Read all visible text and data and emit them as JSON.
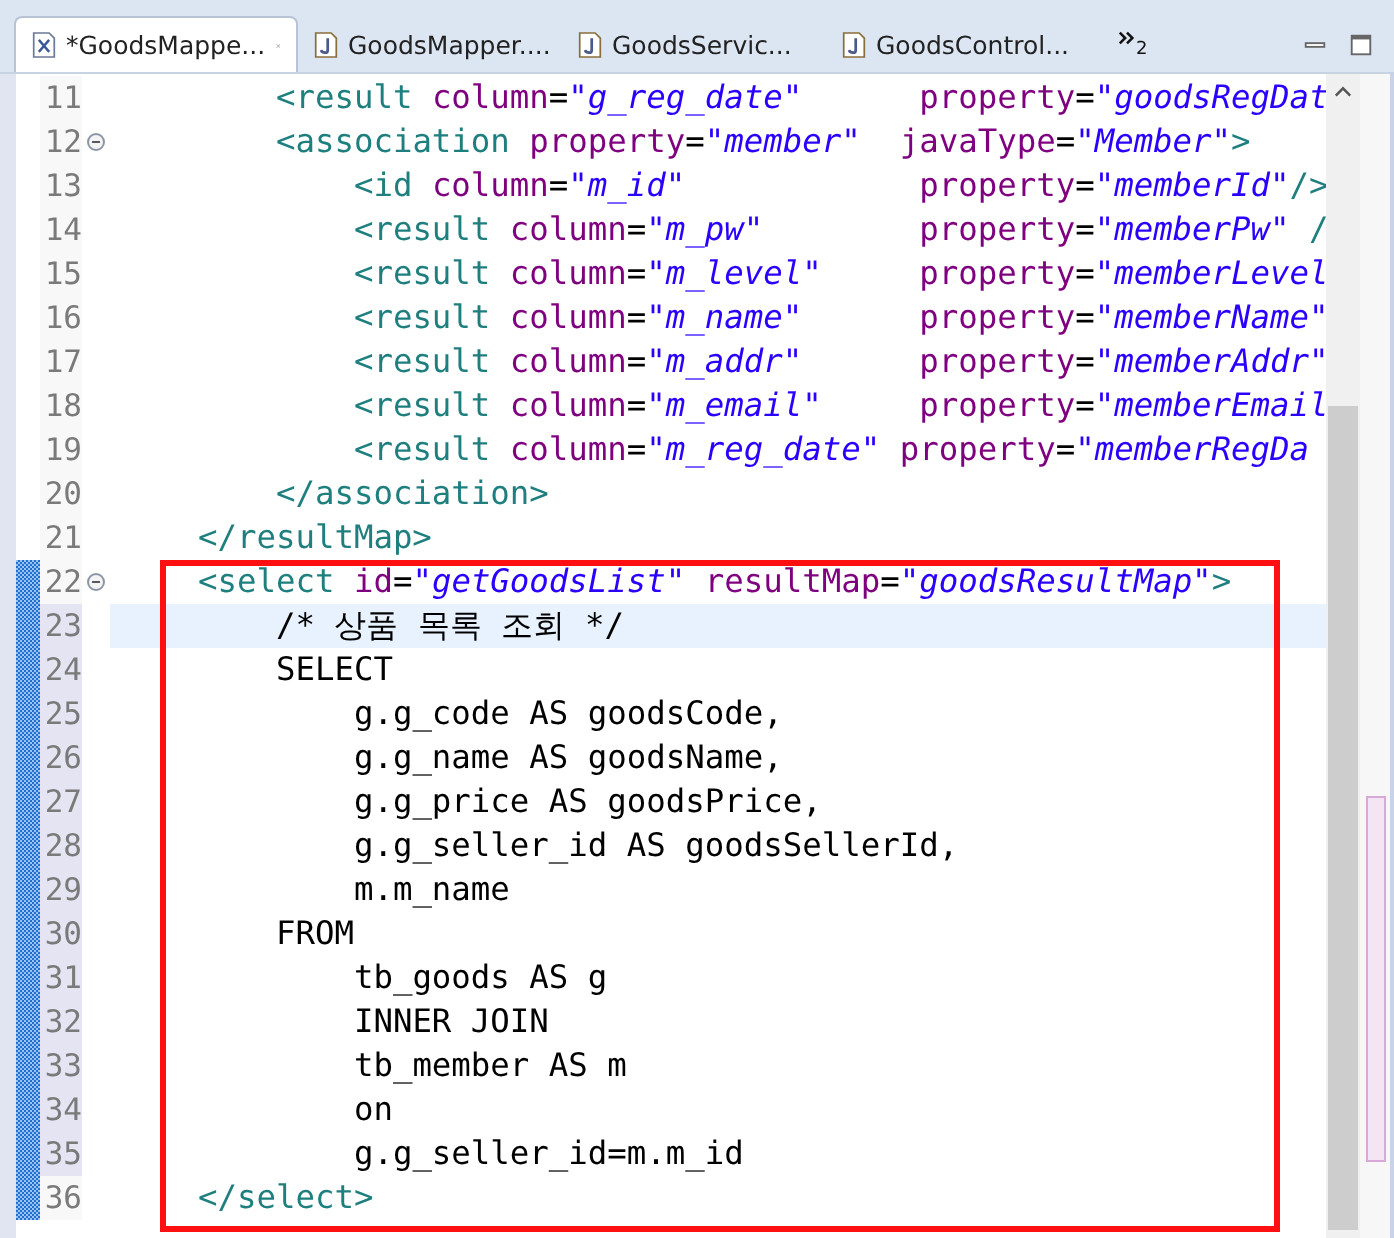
{
  "tabs": [
    {
      "label": "*GoodsMappe...",
      "kind": "xml",
      "selected": true,
      "closable": true
    },
    {
      "label": "GoodsMapper....",
      "kind": "java",
      "selected": false
    },
    {
      "label": "GoodsServic...",
      "kind": "java",
      "selected": false
    },
    {
      "label": "GoodsControl...",
      "kind": "java",
      "selected": false
    }
  ],
  "overflow_count": "2",
  "lines": [
    {
      "number": "11",
      "tokens": [
        {
          "kind": "tag",
          "text": "        <result "
        },
        {
          "kind": "attr",
          "text": "column"
        },
        {
          "kind": "plain",
          "text": "="
        },
        {
          "kind": "value",
          "text": "\"g_reg_date\""
        },
        {
          "kind": "attr",
          "text": "      property"
        },
        {
          "kind": "plain",
          "text": "="
        },
        {
          "kind": "value",
          "text": "\"goodsRegDat"
        }
      ]
    },
    {
      "number": "12",
      "collapsible": true,
      "tokens": [
        {
          "kind": "tag",
          "text": "        <association "
        },
        {
          "kind": "attr",
          "text": "property"
        },
        {
          "kind": "plain",
          "text": "="
        },
        {
          "kind": "value",
          "text": "\"member\""
        },
        {
          "kind": "attr",
          "text": "  javaType"
        },
        {
          "kind": "plain",
          "text": "="
        },
        {
          "kind": "value",
          "text": "\"Member\""
        },
        {
          "kind": "tag",
          "text": ">"
        }
      ]
    },
    {
      "number": "13",
      "tokens": [
        {
          "kind": "tag",
          "text": "            <id "
        },
        {
          "kind": "attr",
          "text": "column"
        },
        {
          "kind": "plain",
          "text": "="
        },
        {
          "kind": "value",
          "text": "\"m_id\""
        },
        {
          "kind": "attr",
          "text": "            property"
        },
        {
          "kind": "plain",
          "text": "="
        },
        {
          "kind": "value",
          "text": "\"memberId\""
        },
        {
          "kind": "tag",
          "text": "/>"
        }
      ]
    },
    {
      "number": "14",
      "tokens": [
        {
          "kind": "tag",
          "text": "            <result "
        },
        {
          "kind": "attr",
          "text": "column"
        },
        {
          "kind": "plain",
          "text": "="
        },
        {
          "kind": "value",
          "text": "\"m_pw\""
        },
        {
          "kind": "attr",
          "text": "        property"
        },
        {
          "kind": "plain",
          "text": "="
        },
        {
          "kind": "value",
          "text": "\"memberPw\""
        },
        {
          "kind": "tag",
          "text": " /"
        }
      ]
    },
    {
      "number": "15",
      "tokens": [
        {
          "kind": "tag",
          "text": "            <result "
        },
        {
          "kind": "attr",
          "text": "column"
        },
        {
          "kind": "plain",
          "text": "="
        },
        {
          "kind": "value",
          "text": "\"m_level\""
        },
        {
          "kind": "attr",
          "text": "     property"
        },
        {
          "kind": "plain",
          "text": "="
        },
        {
          "kind": "value",
          "text": "\"memberLevel"
        }
      ]
    },
    {
      "number": "16",
      "tokens": [
        {
          "kind": "tag",
          "text": "            <result "
        },
        {
          "kind": "attr",
          "text": "column"
        },
        {
          "kind": "plain",
          "text": "="
        },
        {
          "kind": "value",
          "text": "\"m_name\""
        },
        {
          "kind": "attr",
          "text": "      property"
        },
        {
          "kind": "plain",
          "text": "="
        },
        {
          "kind": "value",
          "text": "\"memberName\""
        }
      ]
    },
    {
      "number": "17",
      "tokens": [
        {
          "kind": "tag",
          "text": "            <result "
        },
        {
          "kind": "attr",
          "text": "column"
        },
        {
          "kind": "plain",
          "text": "="
        },
        {
          "kind": "value",
          "text": "\"m_addr\""
        },
        {
          "kind": "attr",
          "text": "      property"
        },
        {
          "kind": "plain",
          "text": "="
        },
        {
          "kind": "value",
          "text": "\"memberAddr\""
        }
      ]
    },
    {
      "number": "18",
      "tokens": [
        {
          "kind": "tag",
          "text": "            <result "
        },
        {
          "kind": "attr",
          "text": "column"
        },
        {
          "kind": "plain",
          "text": "="
        },
        {
          "kind": "value",
          "text": "\"m_email\""
        },
        {
          "kind": "attr",
          "text": "     property"
        },
        {
          "kind": "plain",
          "text": "="
        },
        {
          "kind": "value",
          "text": "\"memberEmail"
        }
      ]
    },
    {
      "number": "19",
      "tokens": [
        {
          "kind": "tag",
          "text": "            <result "
        },
        {
          "kind": "attr",
          "text": "column"
        },
        {
          "kind": "plain",
          "text": "="
        },
        {
          "kind": "value",
          "text": "\"m_reg_date\""
        },
        {
          "kind": "attr",
          "text": " property"
        },
        {
          "kind": "plain",
          "text": "="
        },
        {
          "kind": "value",
          "text": "\"memberRegDa"
        }
      ]
    },
    {
      "number": "20",
      "tokens": [
        {
          "kind": "tag",
          "text": "        </association>"
        }
      ]
    },
    {
      "number": "21",
      "tokens": [
        {
          "kind": "tag",
          "text": "    </resultMap>"
        }
      ]
    },
    {
      "number": "22",
      "collapsible": true,
      "marker": true,
      "tokens": [
        {
          "kind": "tag",
          "text": "    <select "
        },
        {
          "kind": "attr",
          "text": "id"
        },
        {
          "kind": "plain",
          "text": "="
        },
        {
          "kind": "value",
          "text": "\"getGoodsList\""
        },
        {
          "kind": "attr",
          "text": " resultMap"
        },
        {
          "kind": "plain",
          "text": "="
        },
        {
          "kind": "value",
          "text": "\"goodsResultMap\""
        },
        {
          "kind": "tag",
          "text": ">"
        }
      ]
    },
    {
      "number": "23",
      "marker": true,
      "shaded": true,
      "current": true,
      "tokens": [
        {
          "kind": "plain",
          "text": "        /* 상품 목록 조회 */"
        }
      ]
    },
    {
      "number": "24",
      "marker": true,
      "shaded": true,
      "tokens": [
        {
          "kind": "plain",
          "text": "        SELECT"
        }
      ]
    },
    {
      "number": "25",
      "marker": true,
      "shaded": true,
      "tokens": [
        {
          "kind": "plain",
          "text": "            g.g_code AS goodsCode,"
        }
      ]
    },
    {
      "number": "26",
      "marker": true,
      "shaded": true,
      "tokens": [
        {
          "kind": "plain",
          "text": "            g.g_name AS goodsName,"
        }
      ]
    },
    {
      "number": "27",
      "marker": true,
      "shaded": true,
      "tokens": [
        {
          "kind": "plain",
          "text": "            g.g_price AS goodsPrice,"
        }
      ]
    },
    {
      "number": "28",
      "marker": true,
      "shaded": true,
      "tokens": [
        {
          "kind": "plain",
          "text": "            g.g_seller_id AS goodsSellerId,"
        }
      ]
    },
    {
      "number": "29",
      "marker": true,
      "shaded": true,
      "tokens": [
        {
          "kind": "plain",
          "text": "            m.m_name"
        }
      ]
    },
    {
      "number": "30",
      "marker": true,
      "shaded": true,
      "tokens": [
        {
          "kind": "plain",
          "text": "        FROM"
        }
      ]
    },
    {
      "number": "31",
      "marker": true,
      "shaded": true,
      "tokens": [
        {
          "kind": "plain",
          "text": "            tb_goods AS g"
        }
      ]
    },
    {
      "number": "32",
      "marker": true,
      "shaded": true,
      "tokens": [
        {
          "kind": "plain",
          "text": "            INNER JOIN"
        }
      ]
    },
    {
      "number": "33",
      "marker": true,
      "shaded": true,
      "tokens": [
        {
          "kind": "plain",
          "text": "            tb_member AS m"
        }
      ]
    },
    {
      "number": "34",
      "marker": true,
      "shaded": true,
      "tokens": [
        {
          "kind": "plain",
          "text": "            on"
        }
      ]
    },
    {
      "number": "35",
      "marker": true,
      "shaded": true,
      "tokens": [
        {
          "kind": "plain",
          "text": "            g.g_seller_id=m.m_id"
        }
      ]
    },
    {
      "number": "36",
      "marker": true,
      "tokens": [
        {
          "kind": "tag",
          "text": "    </select>"
        }
      ]
    }
  ]
}
